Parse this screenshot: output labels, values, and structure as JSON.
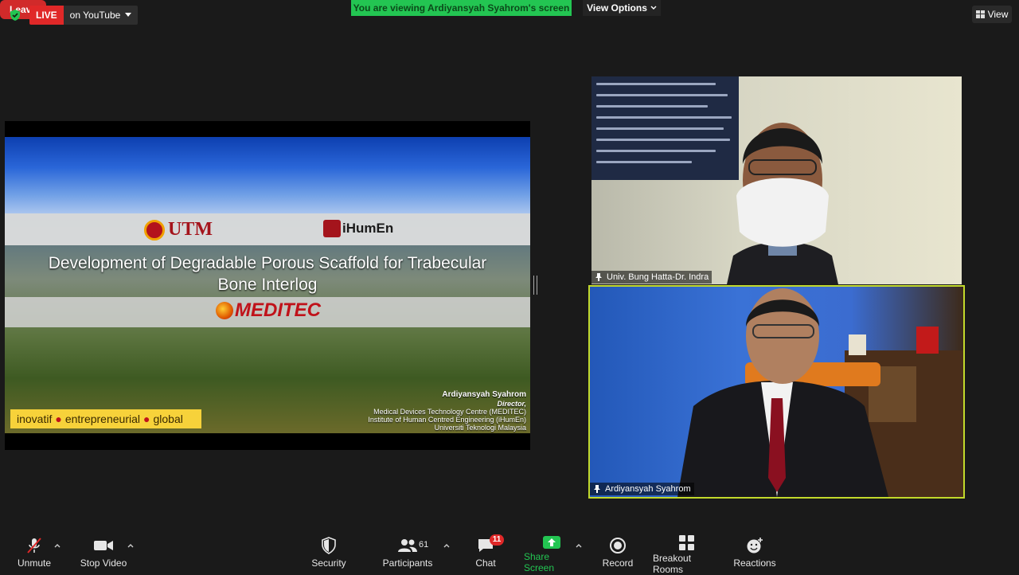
{
  "top_bar": {
    "live_badge": "LIVE",
    "live_destination": "on YouTube",
    "viewing_banner": "You are viewing Ardiyansyah Syahrom's screen",
    "view_options": "View Options",
    "view_button": "View"
  },
  "slide": {
    "utm_logo": "UTM",
    "ihumen_logo": "iHumEn",
    "title_line1": "Development of Degradable Porous Scaffold for Trabecular",
    "title_line2": "Bone Interlog",
    "meditec_logo": "MEDITEC",
    "tagline": [
      "inovatif",
      "entrepreneurial",
      "global"
    ],
    "presenter": {
      "name": "Ardiyansyah Syahrom",
      "role": "Director,",
      "line1": "Medical Devices Technology Centre (MEDITEC)",
      "line2": "Institute of Human Centred Engineering (iHumEn)",
      "line3": "Universiti Teknologi Malaysia"
    }
  },
  "videos": [
    {
      "name": "Univ. Bung Hatta-Dr. Indra"
    },
    {
      "name": "Ardiyansyah Syahrom"
    }
  ],
  "toolbar": {
    "unmute": "Unmute",
    "stop_video": "Stop Video",
    "security": "Security",
    "participants": "Participants",
    "participants_count": "61",
    "chat": "Chat",
    "chat_badge": "11",
    "share_screen": "Share Screen",
    "record": "Record",
    "breakout_rooms": "Breakout Rooms",
    "reactions": "Reactions",
    "leave": "Leave"
  },
  "colors": {
    "live_red": "#e02828",
    "banner_green": "#23c552",
    "active_speaker_border": "#c2d92b",
    "share_green": "#23c552",
    "leave_red": "#d12a2a"
  },
  "icons": [
    "shield-icon",
    "caret-down-icon",
    "grid-view-icon",
    "pin-icon",
    "mic-muted-icon",
    "camera-icon",
    "security-shield-icon",
    "participants-icon",
    "chat-bubble-icon",
    "share-screen-arrow-icon",
    "record-icon",
    "breakout-grid-icon",
    "reactions-smiley-icon"
  ]
}
